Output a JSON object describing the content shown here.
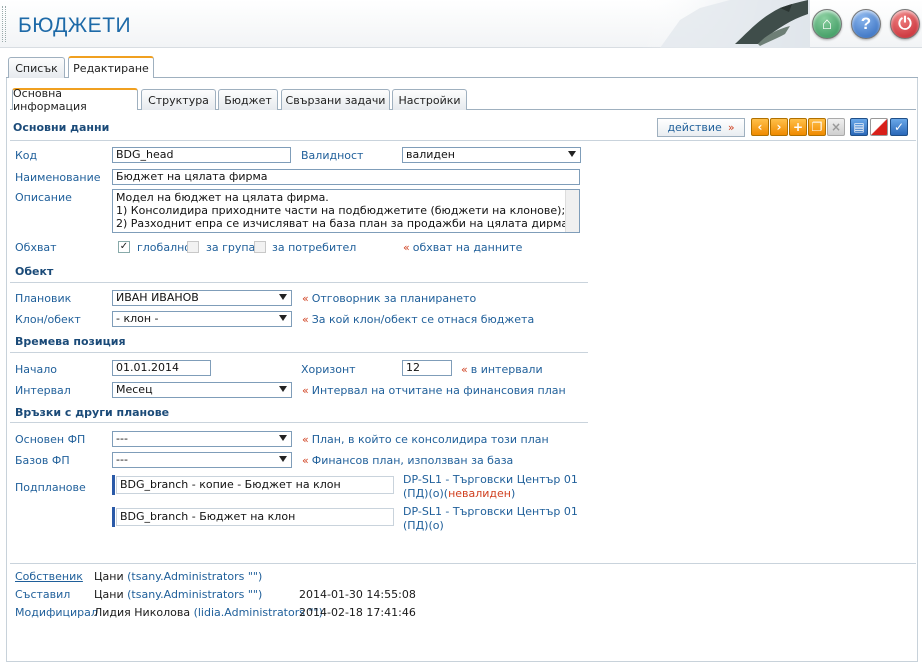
{
  "app": {
    "title": "БЮДЖЕТИ"
  },
  "outer_tabs": [
    {
      "label": "Списък"
    },
    {
      "label": "Редактиране"
    }
  ],
  "inner_tabs": [
    {
      "label": "Основна информация"
    },
    {
      "label": "Структура"
    },
    {
      "label": "Бюджет"
    },
    {
      "label": "Свързани задачи"
    },
    {
      "label": "Настройки"
    }
  ],
  "toolbar": {
    "action_label": "действие",
    "action_marker": "»"
  },
  "sections": {
    "basic": "Основни данни",
    "object": "Обект",
    "time": "Времева позиция",
    "links": "Връзки с други планове"
  },
  "fields": {
    "code": {
      "label": "Код",
      "value": "BDG_head"
    },
    "validity": {
      "label": "Валидност",
      "value": "валиден"
    },
    "name": {
      "label": "Наименование",
      "value": "Бюджет на цялата фирма"
    },
    "description": {
      "label": "Описание",
      "value": "Модел на бюджет на цялата фирма.\n1) Консолидира приходните части на подбюджетите (бюджети на клонове);\n2) Разходнит епра се изчисляват на база план за продажби на цялата дирма, на база"
    },
    "scope": {
      "label": "Обхват",
      "opt_global": "глобално",
      "opt_group": "за група",
      "opt_user": "за потребител",
      "hint": "обхват на данните",
      "global_checked": "✓"
    },
    "planner": {
      "label": "Плановик",
      "value": "ИВАН ИВАНОВ",
      "hint": "Отговорник за планирането"
    },
    "branch": {
      "label": "Клон/обект",
      "value": "- клон -",
      "hint": "За кой клон/обект се отнася бюджета"
    },
    "start": {
      "label": "Начало",
      "value": "01.01.2014"
    },
    "horizon": {
      "label": "Хоризонт",
      "value": "12",
      "hint": "в интервали"
    },
    "interval": {
      "label": "Интервал",
      "value": "Месец",
      "hint": "Интервал на отчитане на финансовия план"
    },
    "main_fp": {
      "label": "Основен ФП",
      "value": "---",
      "hint": "План, в който се консолидира този план"
    },
    "base_fp": {
      "label": "Базов ФП",
      "value": "---",
      "hint": "Финансов план, използван за база"
    },
    "subplans": {
      "label": "Подпланове",
      "items": [
        {
          "name": "BDG_branch - копие - Бюджет на клон",
          "loc1": "DP-SL1 - Търговски Център 01",
          "loc2": "(ПД)(о)(",
          "status": "невалиден",
          "close": ")"
        },
        {
          "name": "BDG_branch - Бюджет на клон",
          "loc1": "DP-SL1 - Търговски Център 01",
          "loc2": "(ПД)(о)",
          "status": "",
          "close": ""
        }
      ]
    }
  },
  "hint_marker": "«",
  "footer": {
    "owner": {
      "label": "Собственик",
      "name": "Цани",
      "account": "(tsany.Administrators \"\")",
      "time": ""
    },
    "author": {
      "label": "Съставил",
      "name": "Цани",
      "account": "(tsany.Administrators \"\")",
      "time": "2014-01-30 14:55:08"
    },
    "modifier": {
      "label": "Модифицирал",
      "name": "Лидия Николова",
      "account": "(lidia.Administrators \"\")",
      "time": "2014-02-18 17:41:46"
    }
  },
  "colors": {
    "title": "#1e6aa8",
    "label": "#1f5f9a",
    "accent": "#f08a00",
    "invalid": "#d04020"
  }
}
